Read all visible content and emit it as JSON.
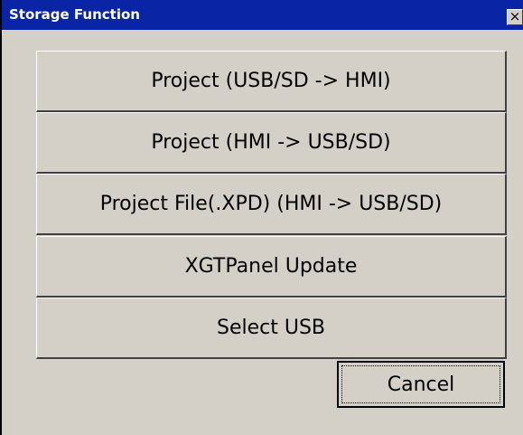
{
  "dialog": {
    "title": "Storage Function",
    "close_label": "×",
    "buttons": [
      {
        "label": "Project (USB/SD -> HMI)"
      },
      {
        "label": "Project (HMI -> USB/SD)"
      },
      {
        "label": "Project File(.XPD) (HMI -> USB/SD)"
      },
      {
        "label": "XGTPanel Update"
      },
      {
        "label": "Select USB"
      }
    ],
    "cancel_label": "Cancel"
  },
  "colors": {
    "titlebar": "#0a24a6",
    "face": "#d4d0c8"
  },
  "icons": {
    "close": "close-icon"
  }
}
